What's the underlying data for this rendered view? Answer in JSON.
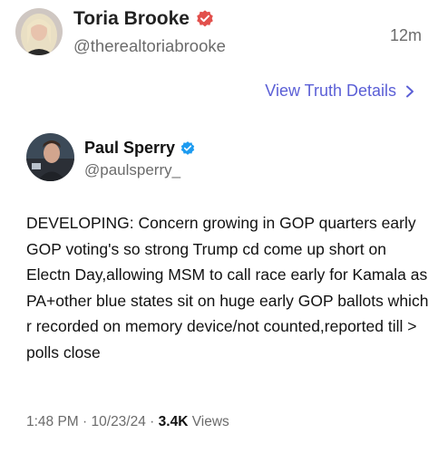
{
  "outer_post": {
    "display_name": "Toria Brooke",
    "handle": "@therealtoriabrooke",
    "timestamp": "12m",
    "view_details_label": "View Truth Details",
    "avatar_icon": "user-avatar-icon",
    "badge_icon": "verified-badge-icon",
    "badge_color": "#e2504c",
    "link_color": "#5b5fd6"
  },
  "embedded_post": {
    "display_name": "Paul Sperry",
    "handle": "@paulsperry_",
    "body": "DEVELOPING: Concern growing in GOP quarters early GOP voting's so strong Trump cd come up short on Electn Day,allowing MSM to call race early for Kamala as PA+other blue states sit on huge early GOP ballots which r recorded on memory device/not counted,reported till > polls close",
    "time": "1:48 PM",
    "date": "10/23/24",
    "views_count": "3.4K",
    "views_label": "Views",
    "badge_color": "#1d9bf0"
  }
}
